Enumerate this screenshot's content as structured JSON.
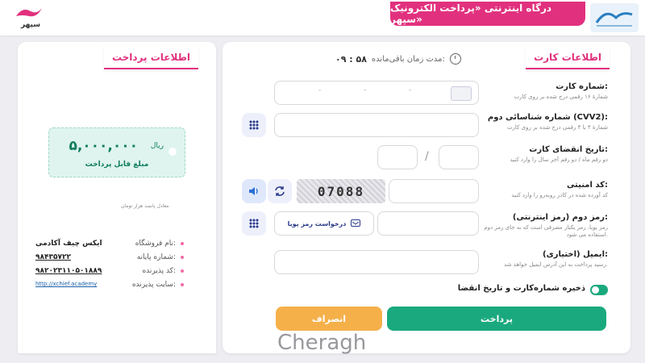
{
  "header": {
    "title": "درگاه اینترنتی «پرداخت الکترونیک سپهر»",
    "sepehr_logo_name": "سپهر",
    "bank_logo_icon": "bank-emblem-icon"
  },
  "card_section": {
    "tab_label": "اطلاعات کارت",
    "timer_label": "مدت زمان باقی‌مانده:",
    "timer_value": "۰۹ : ۵۸",
    "card_number": {
      "title": "شماره کارت:",
      "hint": "شمارهٔ ۱۶ رقمی درج شده بر روی کارت",
      "separators": [
        "-",
        "-",
        "-"
      ]
    },
    "cvv2": {
      "title": "شماره شناسائی دوم (CVV2):",
      "hint": "شمارهٔ ۳ یا ۴ رقمی درج شده بر روی کارت"
    },
    "expiry": {
      "title": "تاریخ انقضای کارت:",
      "hint": "دو رقم ماه / دو رقم آخر سال را وارد کنید",
      "separator": "/"
    },
    "captcha": {
      "title": "کد امنیتی:",
      "hint": "کد آورده شده در کادر روبه‌رو را وارد کنید",
      "image_text": "07088"
    },
    "pin2": {
      "title": "رمز دوم (رمز اینترنتی):",
      "hint": "رمز پویا، رمز یکبار مصرفی است که به جای رمز دوم استفاده می شود.",
      "otp_button": "درخواست رمز پویا"
    },
    "email": {
      "title": "ایمیل (اختیاری):",
      "hint": "رسید پرداخت به این آدرس ایمیل خواهد شد."
    },
    "save_label": "ذخیره شماره‌کارت و تاریخ انقضا",
    "pay_button": "پرداخت",
    "cancel_button": "انصراف"
  },
  "payment_section": {
    "tab_label": "اطلاعات پرداخت",
    "amount": "۵,۰۰۰,۰۰۰",
    "currency": "ریال",
    "amount_caption": "مبلغ قابل پرداخت",
    "equivalent_text": "معادل پانصد هزار تومان",
    "details": [
      {
        "key": "نام فروشگاه:",
        "value": "ایکس چیف آکادمی"
      },
      {
        "key": "شماره پایانه:",
        "value": "۹۸۴۳۵۷۲۲"
      },
      {
        "key": "کد پذیرنده:",
        "value": "۹۸۲۰۲۳۱۱۰۵۰۱۸۸۹"
      },
      {
        "key": "سایت پذیرنده:",
        "value": "http://xchief.academy"
      }
    ]
  },
  "watermark": "Cheragh",
  "colors": {
    "brand": "#e1317e",
    "accent": "#1aa97e",
    "cancel": "#f5b04a"
  }
}
